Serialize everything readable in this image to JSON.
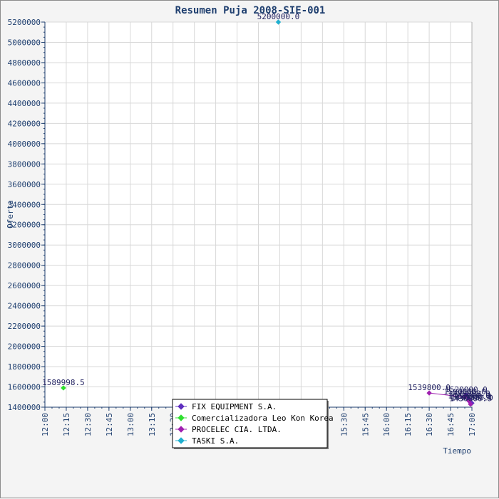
{
  "chart_data": {
    "type": "line",
    "title": "Resumen Puja 2008-SIE-001",
    "xlabel": "Tiempo",
    "ylabel": "Oferta",
    "x_ticks": [
      "12:00",
      "12:15",
      "12:30",
      "12:45",
      "13:00",
      "13:15",
      "13:30",
      "13:45",
      "14:00",
      "14:15",
      "14:30",
      "14:45",
      "15:00",
      "15:15",
      "15:30",
      "15:45",
      "16:00",
      "16:15",
      "16:30",
      "16:45",
      "17:00"
    ],
    "x_range": [
      "12:00",
      "17:00"
    ],
    "y_ticks": [
      1400000,
      1600000,
      1800000,
      2000000,
      2200000,
      2400000,
      2600000,
      2800000,
      3000000,
      3200000,
      3400000,
      3600000,
      3800000,
      4000000,
      4200000,
      4400000,
      4600000,
      4800000,
      5000000,
      5200000
    ],
    "ylim": [
      1400000,
      5200000
    ],
    "grid": true,
    "legend_position": "bottom-center",
    "series": [
      {
        "name": "FIX EQUIPMENT S.A.",
        "color": "#5f2fbf",
        "points": [
          {
            "x": "16:56",
            "y": 1520000,
            "label": "1520000.0"
          },
          {
            "x": "16:58",
            "y": 1480000,
            "label": "1480000.0"
          },
          {
            "x": "16:59",
            "y": 1452000,
            "label": "1452000.0"
          },
          {
            "x": "17:00",
            "y": 1440000,
            "label": "1440000.0"
          }
        ]
      },
      {
        "name": "Comercializadora Leo Kon Korea",
        "color": "#2fdf2f",
        "points": [
          {
            "x": "12:13",
            "y": 1589998.5,
            "label": "1589998.5"
          }
        ]
      },
      {
        "name": "PROCELEC CIA. LTDA.",
        "color": "#9f1faf",
        "points": [
          {
            "x": "16:30",
            "y": 1539800,
            "label": "1539800.0"
          },
          {
            "x": "16:55",
            "y": 1500000,
            "label": "1500000.0"
          },
          {
            "x": "16:58",
            "y": 1460000,
            "label": "1460000.0"
          },
          {
            "x": "16:59",
            "y": 1430000,
            "label": "1430000.0"
          }
        ]
      },
      {
        "name": "TASKI S.A.",
        "color": "#1fafcf",
        "points": [
          {
            "x": "14:44",
            "y": 5200000,
            "label": "5200000.0"
          }
        ]
      }
    ]
  }
}
